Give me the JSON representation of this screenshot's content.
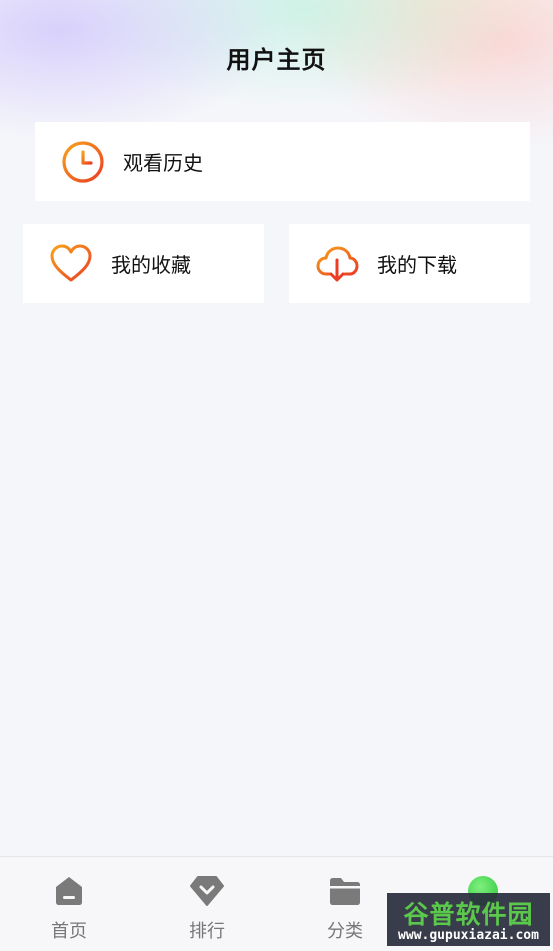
{
  "header": {
    "title": "用户主页"
  },
  "cards": {
    "history": {
      "label": "观看历史",
      "icon": "clock-icon"
    },
    "favorites": {
      "label": "我的收藏",
      "icon": "heart-icon"
    },
    "downloads": {
      "label": "我的下载",
      "icon": "cloud-download-icon"
    }
  },
  "tabbar": {
    "items": [
      {
        "label": "首页",
        "icon": "home-icon"
      },
      {
        "label": "排行",
        "icon": "rank-icon"
      },
      {
        "label": "分类",
        "icon": "folder-icon"
      },
      {
        "label": "",
        "icon": "avatar-dot-icon"
      }
    ]
  },
  "watermark": {
    "main": "谷普软件园",
    "sub": "www.gupuxiazai.com"
  },
  "colors": {
    "accent_orange": "#f7941d",
    "accent_red": "#ee3a24",
    "tab_gray": "#777777",
    "background": "#f5f6fa"
  }
}
